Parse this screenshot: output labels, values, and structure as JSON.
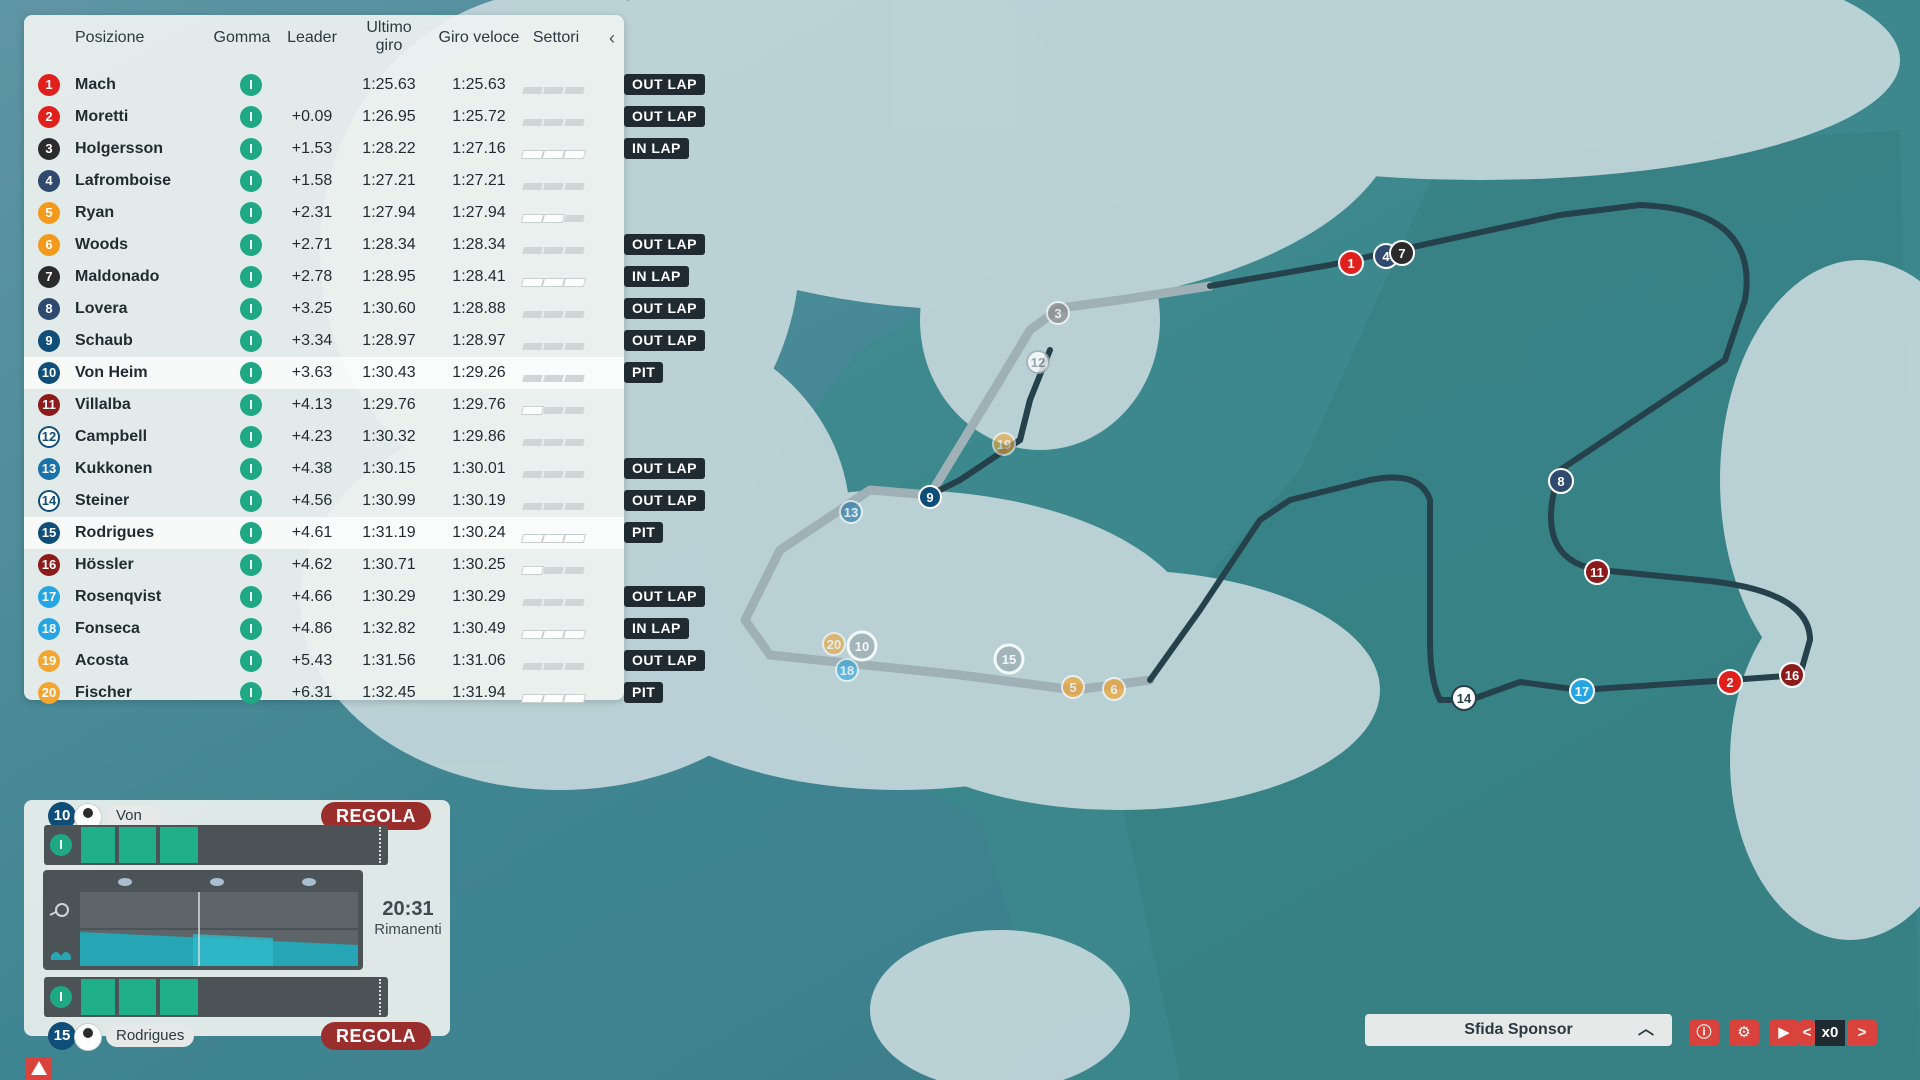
{
  "standings": {
    "headers": {
      "position": "Posizione",
      "tyre": "Gomma",
      "leader": "Leader",
      "last_lap": "Ultimo giro",
      "best_lap": "Giro veloce",
      "sectors": "Settori"
    },
    "rows": [
      {
        "pos": "1",
        "name": "Mach",
        "tyre": "I",
        "gap": "",
        "last": "1:25.63",
        "best": "1:25.63",
        "sectors": 0,
        "status": "OUT LAP",
        "color": "#e0201c"
      },
      {
        "pos": "2",
        "name": "Moretti",
        "tyre": "I",
        "gap": "+0.09",
        "last": "1:26.95",
        "best": "1:25.72",
        "sectors": 0,
        "status": "OUT LAP",
        "color": "#e0201c"
      },
      {
        "pos": "3",
        "name": "Holgersson",
        "tyre": "I",
        "gap": "+1.53",
        "last": "1:28.22",
        "best": "1:27.16",
        "sectors": 3,
        "status": "IN LAP",
        "color": "#2b2b2b"
      },
      {
        "pos": "4",
        "name": "Lafromboise",
        "tyre": "I",
        "gap": "+1.58",
        "last": "1:27.21",
        "best": "1:27.21",
        "sectors": 0,
        "status": "",
        "color": "#2f4a6e"
      },
      {
        "pos": "5",
        "name": "Ryan",
        "tyre": "I",
        "gap": "+2.31",
        "last": "1:27.94",
        "best": "1:27.94",
        "sectors": 2,
        "status": "",
        "color": "#f39a1c"
      },
      {
        "pos": "6",
        "name": "Woods",
        "tyre": "I",
        "gap": "+2.71",
        "last": "1:28.34",
        "best": "1:28.34",
        "sectors": 0,
        "status": "OUT LAP",
        "color": "#f39a1c"
      },
      {
        "pos": "7",
        "name": "Maldonado",
        "tyre": "I",
        "gap": "+2.78",
        "last": "1:28.95",
        "best": "1:28.41",
        "sectors": 3,
        "status": "IN LAP",
        "color": "#2b2b2b"
      },
      {
        "pos": "8",
        "name": "Lovera",
        "tyre": "I",
        "gap": "+3.25",
        "last": "1:30.60",
        "best": "1:28.88",
        "sectors": 0,
        "status": "OUT LAP",
        "color": "#2f4a6e"
      },
      {
        "pos": "9",
        "name": "Schaub",
        "tyre": "I",
        "gap": "+3.34",
        "last": "1:28.97",
        "best": "1:28.97",
        "sectors": 0,
        "status": "OUT LAP",
        "color": "#0f4e79"
      },
      {
        "pos": "10",
        "name": "Von Heim",
        "tyre": "I",
        "gap": "+3.63",
        "last": "1:30.43",
        "best": "1:29.26",
        "sectors": 0,
        "status": "PIT",
        "color": "#0f4e79",
        "highlight": true
      },
      {
        "pos": "11",
        "name": "Villalba",
        "tyre": "I",
        "gap": "+4.13",
        "last": "1:29.76",
        "best": "1:29.76",
        "sectors": 1,
        "status": "",
        "color": "#8e1b1b"
      },
      {
        "pos": "12",
        "name": "Campbell",
        "tyre": "I",
        "gap": "+4.23",
        "last": "1:30.32",
        "best": "1:29.86",
        "sectors": 0,
        "status": "",
        "color": "#ffffff"
      },
      {
        "pos": "13",
        "name": "Kukkonen",
        "tyre": "I",
        "gap": "+4.38",
        "last": "1:30.15",
        "best": "1:30.01",
        "sectors": 0,
        "status": "OUT LAP",
        "color": "#1a73a8"
      },
      {
        "pos": "14",
        "name": "Steiner",
        "tyre": "I",
        "gap": "+4.56",
        "last": "1:30.99",
        "best": "1:30.19",
        "sectors": 0,
        "status": "OUT LAP",
        "color": "#ffffff"
      },
      {
        "pos": "15",
        "name": "Rodrigues",
        "tyre": "I",
        "gap": "+4.61",
        "last": "1:31.19",
        "best": "1:30.24",
        "sectors": 3,
        "status": "PIT",
        "color": "#0f4e79",
        "highlight": true
      },
      {
        "pos": "16",
        "name": "Hössler",
        "tyre": "I",
        "gap": "+4.62",
        "last": "1:30.71",
        "best": "1:30.25",
        "sectors": 1,
        "status": "",
        "color": "#8e1b1b"
      },
      {
        "pos": "17",
        "name": "Rosenqvist",
        "tyre": "I",
        "gap": "+4.66",
        "last": "1:30.29",
        "best": "1:30.29",
        "sectors": 0,
        "status": "OUT LAP",
        "color": "#25a6e3"
      },
      {
        "pos": "18",
        "name": "Fonseca",
        "tyre": "I",
        "gap": "+4.86",
        "last": "1:32.82",
        "best": "1:30.49",
        "sectors": 3,
        "status": "IN LAP",
        "color": "#25a6e3"
      },
      {
        "pos": "19",
        "name": "Acosta",
        "tyre": "I",
        "gap": "+5.43",
        "last": "1:31.56",
        "best": "1:31.06",
        "sectors": 0,
        "status": "OUT LAP",
        "color": "#f3a531"
      },
      {
        "pos": "20",
        "name": "Fischer",
        "tyre": "I",
        "gap": "+6.31",
        "last": "1:32.45",
        "best": "1:31.94",
        "sectors": 3,
        "status": "PIT",
        "color": "#f3a531"
      }
    ]
  },
  "strategy": {
    "driver_top": {
      "num": "10",
      "name": "Von Heim"
    },
    "driver_bottom": {
      "num": "15",
      "name": "Rodrigues"
    },
    "adjust_label": "REGOLA",
    "tyre_label": "I",
    "time_remaining": "20:31",
    "remaining_label": "Rimanenti"
  },
  "controls": {
    "sponsor_label": "Sfida Sponsor",
    "speed_label": "x0",
    "back_label": "<",
    "forward_label": ">"
  },
  "colors": {
    "accent_red": "#d9433b",
    "intermediate_tyre": "#1fa884",
    "pit_button": "#9a2e2c"
  }
}
